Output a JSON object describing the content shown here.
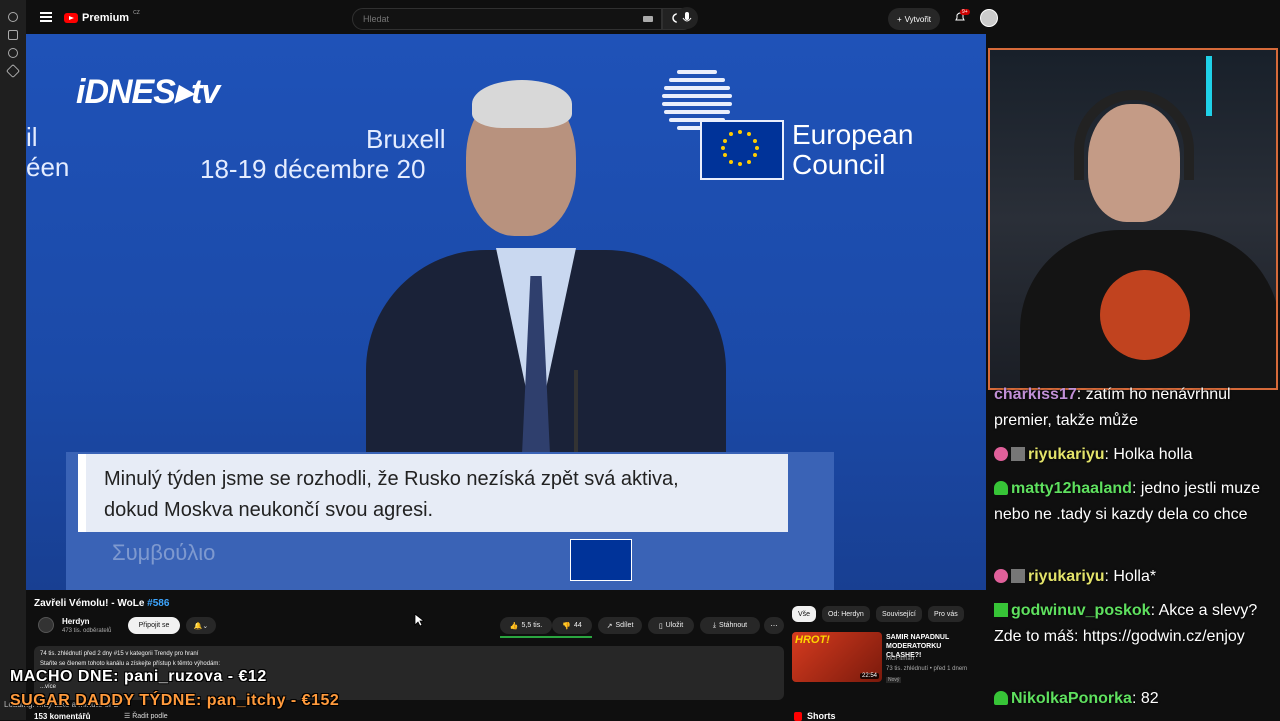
{
  "topbar": {
    "logo_text": "Premium",
    "logo_sup": "CZ",
    "search_placeholder": "Hledat",
    "create_label": "Vytvořit",
    "notification_count": "9+"
  },
  "video_frame": {
    "brand": "iDNES▸tv",
    "left_text": "il\néen",
    "city": "Bruxell",
    "dates": "18-19 décembre 20",
    "council_name": "European\nCouncil",
    "subtitle": "Minulý týden jsme se rozhodli, že Rusko nezíská zpět svá aktiva,\ndokud Moskva neukončí svou agresi.",
    "greek": "Συμβούλιο"
  },
  "video_info": {
    "title": "Zavřeli Vémolu! - WoLe",
    "title_tag": "#586",
    "channel_name": "Herdyn",
    "channel_subs": "473 tis. odběratelů",
    "join_label": "Připojit se",
    "likes": "5,5 tis.",
    "dislikes": "44",
    "share_label": "Sdílet",
    "save_label": "Uložit",
    "download_label": "Stáhnout",
    "desc_meta": "74 tis. zhlédnutí  před 2 dny  #15 v kategorii Trendy pro hraní",
    "desc_line": "Staňte se členem tohoto kanálu a získejte přístup k těmto výhodám:",
    "desc_more": "...více",
    "comments": "153 komentářů",
    "sort_label": "Řadit podle",
    "loading": "Loading: may take a minute or 2"
  },
  "right_column": {
    "chips": [
      "Vše",
      "Od: Herdyn",
      "Související",
      "Pro vás"
    ],
    "rec_thumb_label": "HROT!",
    "rec_duration": "22:54",
    "rec_title": "SAMIR NAPADNUL MODERATORKU CLASHE?!",
    "rec_channel": "MGFitman",
    "rec_meta": "73 tis. zhlédnutí • před 1 dnem",
    "rec_badge": "Nový",
    "shorts_label": "Shorts"
  },
  "chat": [
    {
      "user": "charkiss17",
      "text": ": zatím ho nenávrhnul premier, takže může",
      "user_color": "#c08fd6"
    },
    {
      "user": "riyukariyu",
      "text": ": Holka holla",
      "user_color": "#e3e36a"
    },
    {
      "user": "matty12haaland",
      "text": ": jedno jestli muze nebo ne .tady si kazdy dela co chce",
      "user_color": "#5fe05f"
    },
    {
      "user": "riyukariyu",
      "text": ": Holla*",
      "user_color": "#e3e36a"
    },
    {
      "user": "godwinuv_poskok",
      "text": ": Akce a slevy? Zde to máš: https://godwin.cz/enjoy",
      "user_color": "#5fe05f"
    },
    {
      "user": "NikolkaPonorka",
      "text": ": 82",
      "user_color": "#5fe05f"
    }
  ],
  "overlay": {
    "line1": "MACHO DNE: pani_ruzova - €12",
    "line2": "SUGAR DADDY TÝDNE: pan_itchy - €152"
  }
}
